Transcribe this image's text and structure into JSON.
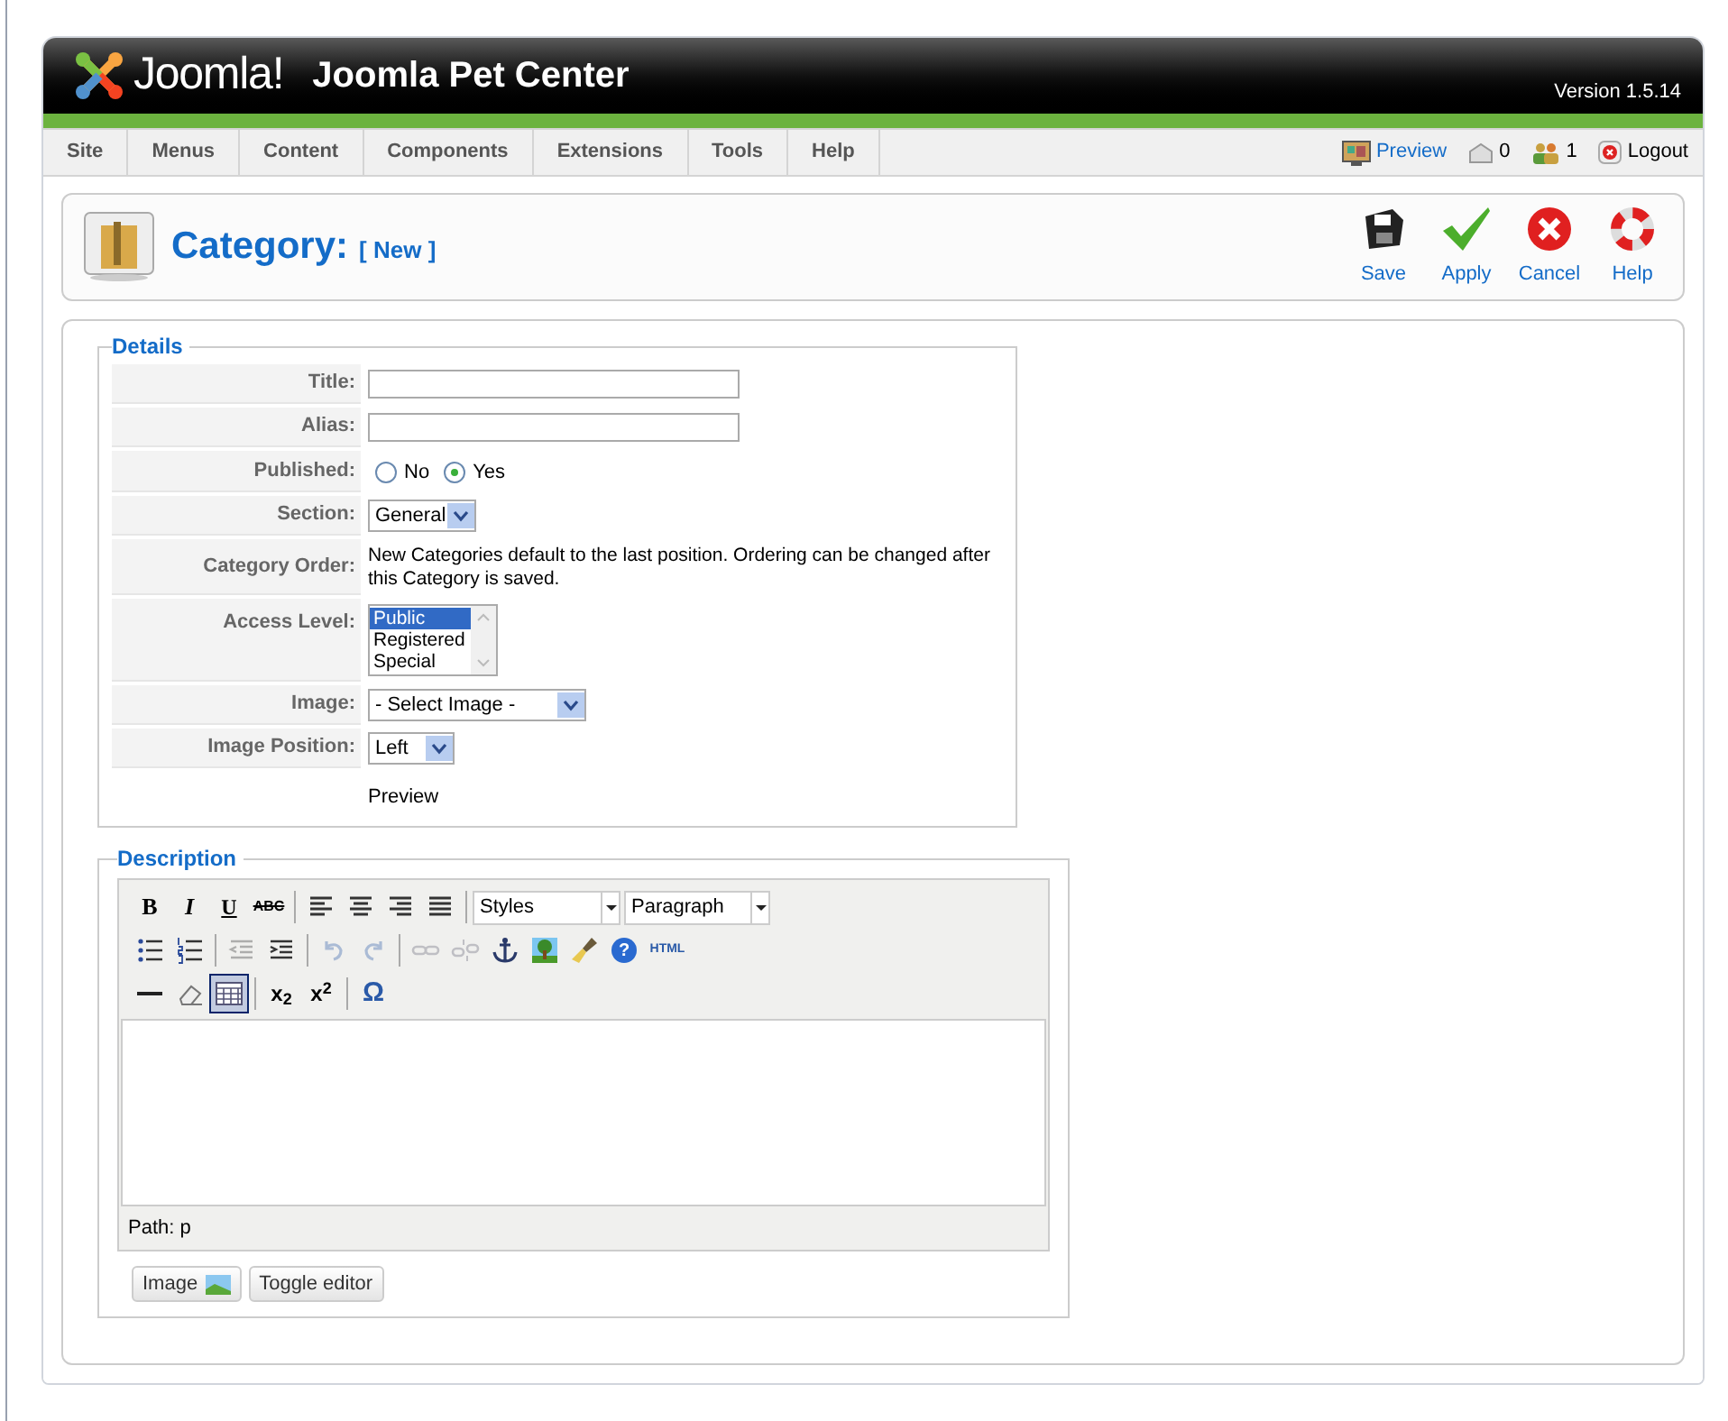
{
  "header": {
    "logo_text": "Joomla!",
    "site_name": "Joomla Pet Center",
    "version": "Version 1.5.14"
  },
  "menu": [
    {
      "label": "Site"
    },
    {
      "label": "Menus"
    },
    {
      "label": "Content"
    },
    {
      "label": "Components"
    },
    {
      "label": "Extensions"
    },
    {
      "label": "Tools"
    },
    {
      "label": "Help"
    }
  ],
  "status": [
    {
      "kind": "preview",
      "label": "Preview"
    },
    {
      "kind": "messages",
      "label": "0"
    },
    {
      "kind": "users",
      "label": "1"
    },
    {
      "kind": "logout",
      "label": "Logout"
    }
  ],
  "toolbar": {
    "title": "Category:",
    "subtitle": "[ New ]",
    "buttons": [
      {
        "kind": "save",
        "label": "Save"
      },
      {
        "kind": "apply",
        "label": "Apply"
      },
      {
        "kind": "cancel",
        "label": "Cancel"
      },
      {
        "kind": "help",
        "label": "Help"
      }
    ]
  },
  "details": {
    "legend": "Details",
    "rows": [
      {
        "kind": "text",
        "label": "Title:"
      },
      {
        "kind": "text",
        "label": "Alias:"
      },
      {
        "kind": "radio",
        "label": "Published:",
        "options": [
          {
            "label": "No",
            "selected": false
          },
          {
            "label": "Yes",
            "selected": true
          }
        ]
      },
      {
        "kind": "select",
        "label": "Section:",
        "value": "General"
      },
      {
        "kind": "note",
        "label": "Category Order:",
        "text": "New Categories default to the last position. Ordering can be changed after this Category is saved."
      },
      {
        "kind": "listbox",
        "label": "Access Level:",
        "options": [
          {
            "label": "Public",
            "selected": true
          },
          {
            "label": "Registered",
            "selected": false
          },
          {
            "label": "Special",
            "selected": false
          }
        ]
      },
      {
        "kind": "select",
        "label": "Image:",
        "value": "- Select Image -"
      },
      {
        "kind": "select",
        "label": "Image Position:",
        "value": "Left"
      },
      {
        "kind": "preview",
        "text": "Preview"
      }
    ]
  },
  "description": {
    "legend": "Description",
    "editor": {
      "rows": [
        [
          {
            "kind": "bold",
            "label": "B",
            "disabled": false,
            "selected": false
          },
          {
            "kind": "italic",
            "label": "I",
            "disabled": false,
            "selected": false
          },
          {
            "kind": "underline",
            "label": "U",
            "disabled": false,
            "selected": false
          },
          {
            "kind": "strike",
            "label": "ABC",
            "disabled": false,
            "selected": false
          },
          {
            "kind": "sep"
          },
          {
            "kind": "align-left",
            "disabled": false,
            "selected": false
          },
          {
            "kind": "align-center",
            "disabled": false,
            "selected": false
          },
          {
            "kind": "align-right",
            "disabled": false,
            "selected": false
          },
          {
            "kind": "justify",
            "disabled": false,
            "selected": false
          },
          {
            "kind": "sep"
          },
          {
            "kind": "dropdown",
            "label": "Styles"
          },
          {
            "kind": "dropdown",
            "label": "Paragraph"
          }
        ],
        [
          {
            "kind": "bullets",
            "disabled": false,
            "selected": false
          },
          {
            "kind": "numbers",
            "disabled": false,
            "selected": false
          },
          {
            "kind": "sep"
          },
          {
            "kind": "outdent",
            "disabled": true,
            "selected": false
          },
          {
            "kind": "indent",
            "disabled": false,
            "selected": false
          },
          {
            "kind": "sep"
          },
          {
            "kind": "undo",
            "disabled": true,
            "selected": false
          },
          {
            "kind": "redo",
            "disabled": true,
            "selected": false
          },
          {
            "kind": "sep"
          },
          {
            "kind": "link",
            "disabled": true,
            "selected": false
          },
          {
            "kind": "unlink",
            "disabled": true,
            "selected": false
          },
          {
            "kind": "anchor",
            "disabled": false,
            "selected": false
          },
          {
            "kind": "image",
            "disabled": false,
            "selected": false
          },
          {
            "kind": "cleanup",
            "disabled": false,
            "selected": false
          },
          {
            "kind": "help",
            "label": "?",
            "disabled": false,
            "selected": false
          },
          {
            "kind": "html",
            "label": "HTML",
            "disabled": false,
            "selected": false
          }
        ],
        [
          {
            "kind": "rule",
            "disabled": false,
            "selected": false
          },
          {
            "kind": "eraser",
            "disabled": false,
            "selected": false
          },
          {
            "kind": "visual-aid",
            "disabled": false,
            "selected": true
          },
          {
            "kind": "sep"
          },
          {
            "kind": "subscript",
            "label": "x$_{2}$",
            "disabled": false,
            "selected": false
          },
          {
            "kind": "superscript",
            "label": "x$^{2}$",
            "disabled": false,
            "selected": false
          },
          {
            "kind": "sep"
          },
          {
            "kind": "charmap",
            "label": "Ω",
            "disabled": false,
            "selected": false
          }
        ]
      ],
      "path": "Path: p"
    },
    "buttons": [
      {
        "kind": "image",
        "label": "Image"
      },
      {
        "kind": "toggle",
        "label": "Toggle editor"
      }
    ]
  }
}
